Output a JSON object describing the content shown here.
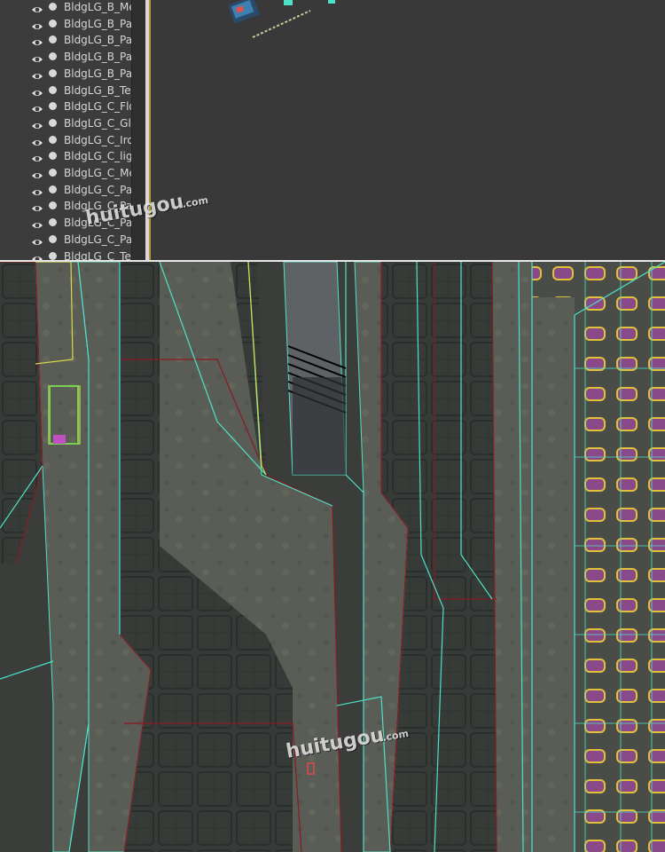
{
  "outliner": {
    "items": [
      {
        "label": "BldgLG_B_Me"
      },
      {
        "label": "BldgLG_B_Pa"
      },
      {
        "label": "BldgLG_B_Pa"
      },
      {
        "label": "BldgLG_B_Pa"
      },
      {
        "label": "BldgLG_B_Pa"
      },
      {
        "label": "BldgLG_B_Te"
      },
      {
        "label": "BldgLG_C_Flo"
      },
      {
        "label": "BldgLG_C_Gl"
      },
      {
        "label": "BldgLG_C_Iro"
      },
      {
        "label": "BldgLG_C_lig"
      },
      {
        "label": "BldgLG_C_Me"
      },
      {
        "label": "BldgLG_C_Pa"
      },
      {
        "label": "BldgLG_C_Pa"
      },
      {
        "label": "BldgLG_C_Pa"
      },
      {
        "label": "BldgLG_C_Pa"
      },
      {
        "label": "BldgLG_C_Te"
      }
    ]
  },
  "watermark": {
    "main": "huitugou",
    "sub": ".com"
  },
  "colors": {
    "wire_cyan": "#4fe0c8",
    "wire_red": "#8a1a22",
    "wire_yellow": "#d8d84a",
    "window_purple": "#8a4a8a",
    "window_yellow": "#e0c23a"
  }
}
